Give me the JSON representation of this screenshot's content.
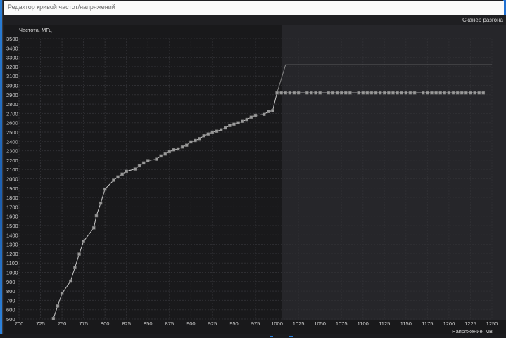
{
  "window": {
    "title": "Редактор кривой частот/напряжений"
  },
  "toolbar": {
    "scanner_label": "Сканер разгона"
  },
  "chart_data": {
    "type": "line",
    "title": "",
    "ylabel": "Частота, МГц",
    "xlabel": "Напряжение, мВ",
    "xlim": [
      700,
      1250
    ],
    "ylim": [
      500,
      3500
    ],
    "x_ticks": [
      700,
      725,
      750,
      775,
      800,
      825,
      850,
      875,
      900,
      925,
      950,
      975,
      1000,
      1025,
      1050,
      1075,
      1100,
      1125,
      1150,
      1175,
      1200,
      1225,
      1250
    ],
    "y_ticks": [
      500,
      600,
      700,
      800,
      900,
      1000,
      1100,
      1200,
      1300,
      1400,
      1500,
      1600,
      1700,
      1800,
      1900,
      2000,
      2100,
      2200,
      2300,
      2400,
      2500,
      2600,
      2700,
      2800,
      2900,
      3000,
      3100,
      3200,
      3300,
      3400,
      3500
    ],
    "grid": true,
    "shaded_region_from_x": 1006,
    "colors": {
      "curve": "#c8c8c8",
      "point": "#9a9a9a",
      "upper_line": "#8a8a8a",
      "grid": "#2f2f33",
      "shade": "#26262a"
    },
    "series": [
      {
        "x": [
          740,
          745,
          750,
          760,
          765,
          770,
          775,
          787,
          790,
          795,
          800,
          810,
          815,
          820,
          825,
          835,
          840,
          845,
          850,
          860,
          865,
          870,
          875,
          880,
          885,
          890,
          895,
          900,
          905,
          910,
          915,
          920,
          925,
          930,
          935,
          940,
          945,
          950,
          955,
          960,
          965,
          970,
          975,
          985,
          990,
          995,
          1000,
          1005,
          1010,
          1015,
          1020,
          1025,
          1035,
          1040,
          1045,
          1050,
          1060,
          1065,
          1070,
          1075,
          1080,
          1085,
          1095,
          1100,
          1105,
          1110,
          1115,
          1120,
          1125,
          1130,
          1135,
          1140,
          1145,
          1150,
          1155,
          1160,
          1170,
          1175,
          1180,
          1185,
          1190,
          1195,
          1200,
          1205,
          1210,
          1215,
          1220,
          1225,
          1230,
          1235,
          1240
        ],
        "y": [
          505,
          640,
          775,
          905,
          1050,
          1195,
          1330,
          1475,
          1605,
          1740,
          1890,
          1985,
          2020,
          2050,
          2080,
          2105,
          2140,
          2170,
          2195,
          2210,
          2245,
          2265,
          2290,
          2310,
          2320,
          2340,
          2360,
          2395,
          2410,
          2430,
          2460,
          2480,
          2500,
          2510,
          2525,
          2545,
          2570,
          2585,
          2600,
          2615,
          2635,
          2660,
          2680,
          2690,
          2720,
          2730,
          2920,
          2920,
          2920,
          2920,
          2920,
          2920,
          2920,
          2920,
          2920,
          2920,
          2920,
          2920,
          2920,
          2920,
          2920,
          2920,
          2920,
          2920,
          2920,
          2920,
          2920,
          2920,
          2920,
          2920,
          2920,
          2920,
          2920,
          2920,
          2920,
          2920,
          2920,
          2920,
          2920,
          2920,
          2920,
          2920,
          2920,
          2920,
          2920,
          2920,
          2920,
          2920,
          2920,
          2920,
          2920
        ]
      }
    ],
    "upper_line": {
      "x": [
        1000,
        1010,
        1250
      ],
      "y": [
        2920,
        3220,
        3220
      ]
    }
  }
}
